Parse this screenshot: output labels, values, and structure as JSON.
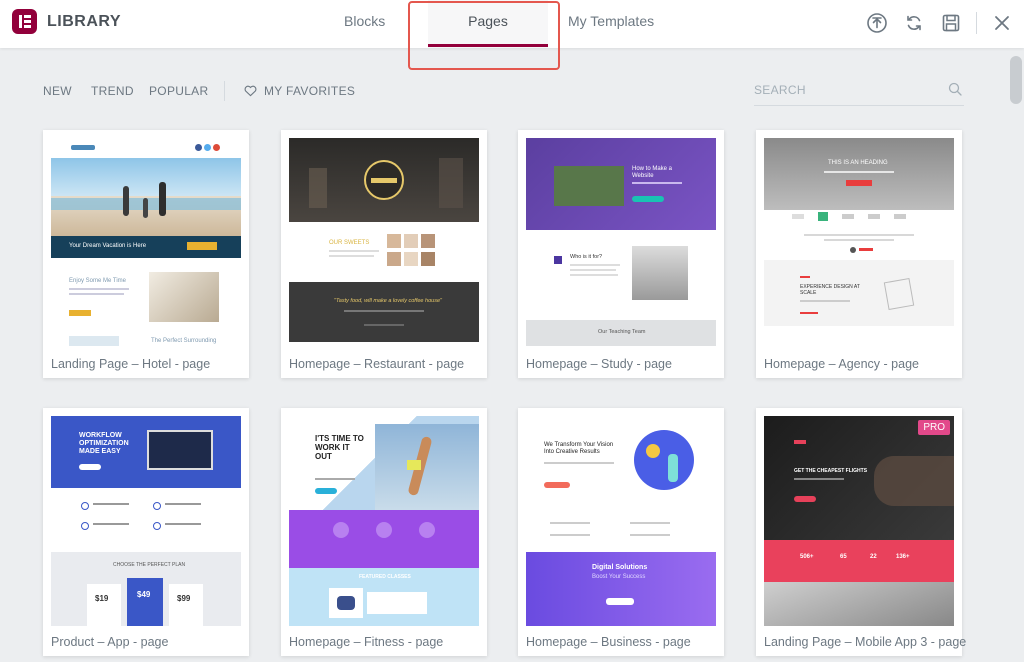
{
  "header": {
    "brand": "LIBRARY",
    "tabs": [
      {
        "label": "Blocks",
        "active": false
      },
      {
        "label": "Pages",
        "active": true
      },
      {
        "label": "My Templates",
        "active": false
      }
    ],
    "icons": [
      "upload-icon",
      "sync-icon",
      "save-icon",
      "close-icon"
    ],
    "accent_color": "#93003c"
  },
  "filters": {
    "items": [
      "NEW",
      "TREND",
      "POPULAR"
    ],
    "favorites": "MY FAVORITES",
    "search_placeholder": "SEARCH"
  },
  "templates": [
    {
      "title": "Landing Page – Hotel - page",
      "pro": false
    },
    {
      "title": "Homepage – Restaurant - page",
      "pro": false
    },
    {
      "title": "Homepage – Study - page",
      "pro": false
    },
    {
      "title": "Homepage – Agency - page",
      "pro": false
    },
    {
      "title": "Product – App - page",
      "pro": false
    },
    {
      "title": "Homepage – Fitness - page",
      "pro": false
    },
    {
      "title": "Homepage – Business - page",
      "pro": false
    },
    {
      "title": "Landing Page – Mobile App 3 - page",
      "pro": true,
      "badge": "PRO"
    }
  ],
  "thumb_text": {
    "hotel_banner": "Your Dream Vacation is Here",
    "hotel_sub": "Enjoy Some Me Time",
    "hotel_sub2": "The Perfect Surrounding",
    "restaurant_quote": "\"Tasty food, will make a lovely coffee house\"",
    "restaurant_sec": "OUR SWEETS",
    "study_hero": "How to Make a Website",
    "study_sec": "Who is it for?",
    "study_team": "Our Teaching Team",
    "agency_hero": "THIS IS AN HEADING",
    "agency_sec": "EXPERIENCE DESIGN AT SCALE",
    "app_hero": "WORKFLOW OPTIMIZATION MADE EASY",
    "app_plan": "CHOOSE THE PERFECT PLAN",
    "app_prices": [
      "$19",
      "$49",
      "$99"
    ],
    "fitness_hero": "I'TS TIME TO WORK IT OUT",
    "fitness_sec": "FEATURED CLASSES",
    "business_hero": "We Transform Your Vision Into Creative Results",
    "business_sec": "Digital Solutions",
    "business_sub": "Boost Your Success",
    "mobile_hero": "GET THE CHEAPEST FLIGHTS",
    "mobile_stats": [
      "506+",
      "65",
      "22",
      "136+"
    ]
  }
}
